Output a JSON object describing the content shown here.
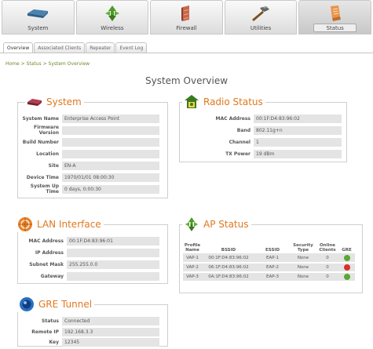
{
  "nav": {
    "tabs": [
      {
        "label": "System",
        "icon": "router-device-icon"
      },
      {
        "label": "Wireless",
        "icon": "wireless-arrows-icon"
      },
      {
        "label": "Firewall",
        "icon": "firewall-icon"
      },
      {
        "label": "Utilities",
        "icon": "hammer-tools-icon"
      },
      {
        "label": "Status",
        "icon": "status-clipboard-icon",
        "active": true
      }
    ]
  },
  "subtabs": [
    {
      "label": "Overview",
      "active": true
    },
    {
      "label": "Associated Clients"
    },
    {
      "label": "Repeater"
    },
    {
      "label": "Event Log"
    }
  ],
  "breadcrumb": "Home > Status > System Overview",
  "page_title": "System Overview",
  "system": {
    "title": "System",
    "rows": [
      {
        "label": "System Name",
        "value": "Enterprise Access Point"
      },
      {
        "label": "Firmware Version",
        "value": ""
      },
      {
        "label": "Build Number",
        "value": ""
      },
      {
        "label": "Location",
        "value": ""
      },
      {
        "label": "Site",
        "value": "EN-A"
      },
      {
        "label": "Device Time",
        "value": "1970/01/01 08:00:30"
      },
      {
        "label": "System Up Time",
        "value": "0 days, 0:00:30"
      }
    ]
  },
  "radio": {
    "title": "Radio Status",
    "rows": [
      {
        "label": "MAC Address",
        "value": "00:1F:D4:83:96:02"
      },
      {
        "label": "Band",
        "value": "802.11g+n"
      },
      {
        "label": "Channel",
        "value": "1"
      },
      {
        "label": "TX Power",
        "value": "19 dBm"
      }
    ]
  },
  "lan": {
    "title": "LAN Interface",
    "rows": [
      {
        "label": "MAC Address",
        "value": "00:1F:D4:83:96:01"
      },
      {
        "label": "IP Address",
        "value": ""
      },
      {
        "label": "Subnet Mask",
        "value": "255.255.0.0"
      },
      {
        "label": "Gateway",
        "value": ""
      }
    ]
  },
  "ap": {
    "title": "AP Status",
    "headers": {
      "profile": "Profile Name",
      "bssid": "BSSID",
      "essid": "ESSID",
      "security": "Security Type",
      "clients": "Online Clients",
      "gre": "GRE"
    },
    "rows": [
      {
        "profile": "VAP-1",
        "bssid": "00:1F:D4:83:96:02",
        "essid": "EAP-1",
        "security": "None",
        "clients": "0",
        "gre": "green"
      },
      {
        "profile": "VAP-2",
        "bssid": "06:1F:D4:83:96:02",
        "essid": "EAP-2",
        "security": "None",
        "clients": "0",
        "gre": "red"
      },
      {
        "profile": "VAP-3",
        "bssid": "0A:1F:D4:83:96:02",
        "essid": "EAP-3",
        "security": "None",
        "clients": "0",
        "gre": "green"
      }
    ]
  },
  "gre": {
    "title": "GRE Tunnel",
    "rows": [
      {
        "label": "Status",
        "value": "Connected"
      },
      {
        "label": "Remote IP",
        "value": "192.168.3.3"
      },
      {
        "label": "Key",
        "value": "12345"
      }
    ]
  },
  "colors": {
    "accent": "#e0781e",
    "breadcrumb": "#6a8a2a",
    "ok": "#5aa832",
    "error": "#d8302a"
  }
}
